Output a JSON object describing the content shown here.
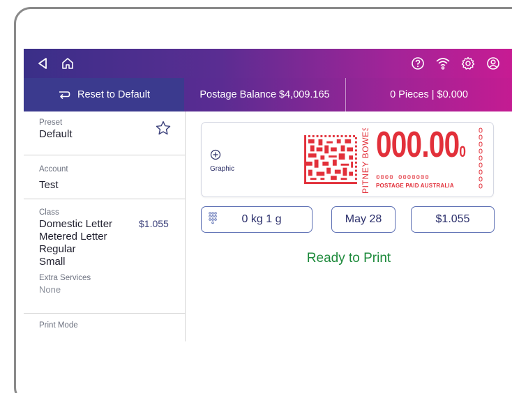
{
  "topbar": {
    "icons": [
      "back-triangle-icon",
      "home-icon",
      "help-icon",
      "wifi-icon",
      "settings-gear-icon",
      "user-account-icon"
    ]
  },
  "actionbar": {
    "reset_label": "Reset to Default",
    "postage_balance": "Postage Balance $4,009.165",
    "pieces": "0 Pieces | $0.000"
  },
  "sidebar": {
    "preset": {
      "label": "Preset",
      "value": "Default"
    },
    "account": {
      "label": "Account",
      "value": "Test"
    },
    "class": {
      "label": "Class",
      "line1": "Domestic Letter",
      "price": "$1.055",
      "line2": "Metered Letter",
      "line3": "Regular",
      "line4": "Small"
    },
    "extra_services": {
      "label": "Extra Services",
      "value": "None"
    },
    "print_mode": {
      "label": "Print Mode"
    }
  },
  "stamp": {
    "graphic_label": "Graphic",
    "brand_vertical": "PITNEY BOWES",
    "amount_main": "000.00",
    "amount_sub": "0",
    "serial": "0000    0000000",
    "postage_paid": "POSTAGE PAID AUSTRALIA"
  },
  "controls": {
    "weight": "0 kg 1 g",
    "date": "May 28",
    "price": "$1.055"
  },
  "status": {
    "ready_text": "Ready to Print"
  },
  "colors": {
    "gradient_start": "#3a2f88",
    "gradient_end": "#c71b93",
    "stamp_red": "#e2303a",
    "ready_green": "#1d8a3b",
    "pill_border": "#5b6eb3"
  }
}
